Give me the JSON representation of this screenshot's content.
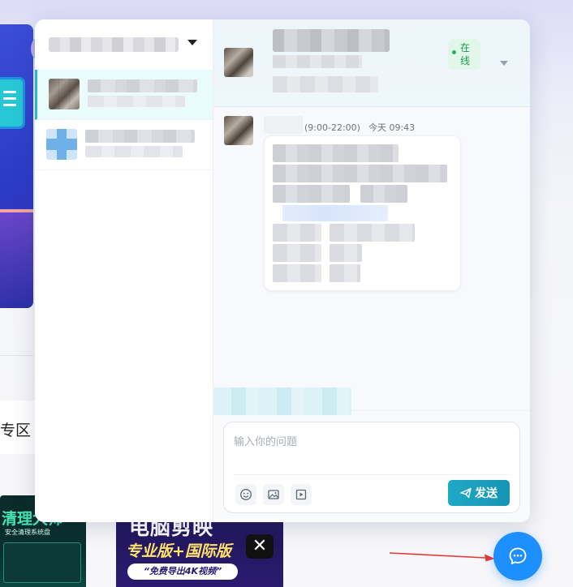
{
  "background": {
    "zone_label": "专区",
    "thumb_left": {
      "title": "清理大师",
      "subtitle": "安全清理系统盘"
    },
    "thumb_right": {
      "title": "电脑剪映",
      "subtitle": "专业版+国际版",
      "badge": "“免费导出4K视频”"
    }
  },
  "chat": {
    "header": {
      "status": "在线",
      "status_color": "#1c9a4a"
    },
    "message": {
      "service_hours": "(9:00-22:00)",
      "time": "今天 09:43"
    },
    "composer": {
      "placeholder": "输入你的问题",
      "send_label": "发送",
      "tools": [
        "emoji-icon",
        "image-icon",
        "video-icon"
      ]
    },
    "accent": "#1fa9c6"
  },
  "launcher": {
    "icon": "chat-bubble-icon",
    "color": "#1e8fff"
  }
}
